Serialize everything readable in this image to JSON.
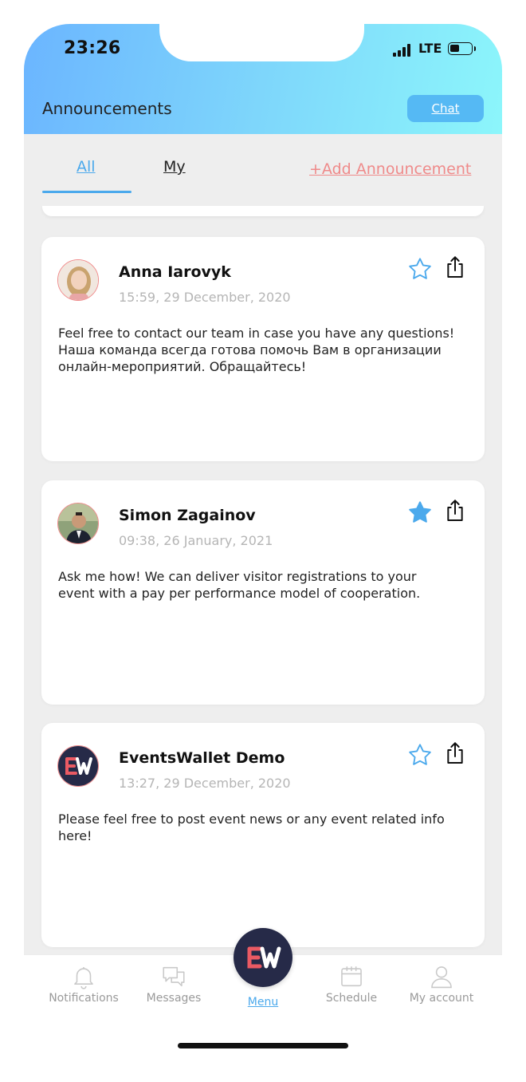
{
  "status_bar": {
    "time": "23:26",
    "network": "LTE"
  },
  "header": {
    "title": "Announcements",
    "chat_label": "Chat"
  },
  "tabs": {
    "all_label": "All",
    "my_label": "My",
    "add_label": "+Add Announcement"
  },
  "announcements": [
    {
      "author": "Anna Iarovyk",
      "date": "15:59, 29 December, 2020",
      "text": "Feel free to contact our team in case you have any questions!\nНаша команда всегда готова помочь Вам в организации онлайн-мероприятий. Обращайтесь!",
      "starred": false,
      "avatar": "photo"
    },
    {
      "author": "Simon Zagainov",
      "date": "09:38, 26 January, 2021",
      "text": "Ask me how! We can deliver visitor registrations to your event with a pay per performance model of cooperation.",
      "starred": true,
      "avatar": "photo"
    },
    {
      "author": "EventsWallet Demo",
      "date": "13:27, 29 December, 2020",
      "text": "Please feel free to post event news or any event related info here!",
      "starred": false,
      "avatar": "logo"
    }
  ],
  "bottom_nav": {
    "notifications": "Notifications",
    "messages": "Messages",
    "menu": "Menu",
    "schedule": "Schedule",
    "account": "My account"
  },
  "icons": {
    "star": "star-icon",
    "share": "share-icon",
    "notifications": "bell-icon",
    "messages": "chat-bubbles-icon",
    "schedule": "calendar-icon",
    "account": "user-icon"
  },
  "colors": {
    "accent": "#4ba9ec",
    "add_link": "#ef8a8a",
    "header_gradient_start": "#6bb5ff",
    "header_gradient_end": "#8cf6fb",
    "menu_button": "#262a48"
  }
}
